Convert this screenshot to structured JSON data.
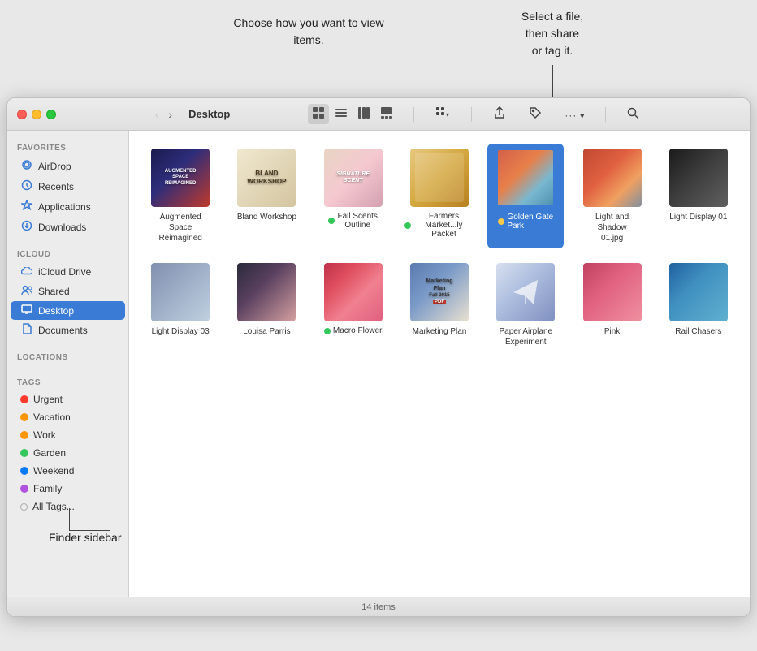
{
  "window": {
    "title": "Desktop"
  },
  "annotations": {
    "view_callout": "Choose how you\nwant to view items.",
    "share_callout": "Select a file,\nthen share\nor tag it.",
    "sidebar_label": "Finder sidebar"
  },
  "sidebar": {
    "favorites_header": "Favorites",
    "icloud_header": "iCloud",
    "locations_header": "Locations",
    "tags_header": "Tags",
    "favorites": [
      {
        "id": "airdrop",
        "label": "AirDrop",
        "icon": "📡"
      },
      {
        "id": "recents",
        "label": "Recents",
        "icon": "🕐"
      },
      {
        "id": "applications",
        "label": "Applications",
        "icon": "🚀"
      },
      {
        "id": "downloads",
        "label": "Downloads",
        "icon": "⬇"
      }
    ],
    "icloud": [
      {
        "id": "icloud-drive",
        "label": "iCloud Drive",
        "icon": "☁"
      },
      {
        "id": "shared",
        "label": "Shared",
        "icon": "👥"
      },
      {
        "id": "desktop",
        "label": "Desktop",
        "icon": "🖥",
        "active": true
      },
      {
        "id": "documents",
        "label": "Documents",
        "icon": "📄"
      }
    ],
    "tags": [
      {
        "id": "urgent",
        "label": "Urgent",
        "color": "#ff3b30"
      },
      {
        "id": "vacation",
        "label": "Vacation",
        "color": "#ff9500"
      },
      {
        "id": "work",
        "label": "Work",
        "color": "#ff9500"
      },
      {
        "id": "garden",
        "label": "Garden",
        "color": "#34c759"
      },
      {
        "id": "weekend",
        "label": "Weekend",
        "color": "#007aff"
      },
      {
        "id": "family",
        "label": "Family",
        "color": "#af52de"
      },
      {
        "id": "all-tags",
        "label": "All Tags...",
        "color": "#aaa"
      }
    ]
  },
  "toolbar": {
    "view_icon": "⊞",
    "list_icon": "≡",
    "column_icon": "⫿",
    "gallery_icon": "⊟",
    "group_icon": "⊞",
    "share_icon": "↑",
    "tag_icon": "🏷",
    "more_icon": "•••",
    "search_icon": "🔍",
    "back_disabled": true,
    "forward_enabled": true
  },
  "files": [
    {
      "id": "augmented",
      "label": "Augmented\nSpace Reimagined",
      "thumb_class": "thumb-augmented",
      "dot": null,
      "selected": false,
      "text_overlay": "AUGMENTED\nSPACE\nREIMAGINED"
    },
    {
      "id": "bland-workshop",
      "label": "Bland Workshop",
      "thumb_class": "thumb-bland",
      "dot": null,
      "selected": false,
      "text_overlay": "BLAND\nWORKSHOP"
    },
    {
      "id": "fall-scents",
      "label": "Fall Scents\nOutline",
      "thumb_class": "thumb-fall-scents",
      "dot": "#34c759",
      "selected": false,
      "text_overlay": "SIGNATURE\nSCENT"
    },
    {
      "id": "farmers-market",
      "label": "Farmers\nMarket...ly Packet",
      "thumb_class": "thumb-farmers",
      "dot": "#34c759",
      "selected": false,
      "text_overlay": ""
    },
    {
      "id": "golden-gate",
      "label": "Golden Gate\nPark",
      "thumb_class": "thumb-golden-gate",
      "dot": null,
      "selected": true,
      "text_overlay": ""
    },
    {
      "id": "light-shadow",
      "label": "Light and Shadow\n01.jpg",
      "thumb_class": "thumb-light-shadow",
      "dot": null,
      "selected": false,
      "text_overlay": ""
    },
    {
      "id": "light-display-01",
      "label": "Light Display 01",
      "thumb_class": "thumb-light-display-01",
      "dot": null,
      "selected": false,
      "text_overlay": ""
    },
    {
      "id": "light-display-03",
      "label": "Light Display 03",
      "thumb_class": "thumb-light-display-03",
      "dot": null,
      "selected": false,
      "text_overlay": ""
    },
    {
      "id": "louisa-parris",
      "label": "Louisa Parris",
      "thumb_class": "thumb-louisa",
      "dot": null,
      "selected": false,
      "text_overlay": ""
    },
    {
      "id": "macro-flower",
      "label": "Macro Flower",
      "thumb_class": "thumb-macro-flower",
      "dot": "#34c759",
      "selected": false,
      "text_overlay": ""
    },
    {
      "id": "marketing-plan",
      "label": "Marketing Plan",
      "thumb_class": "thumb-marketing",
      "dot": null,
      "selected": false,
      "text_overlay": "Marketing\nPlan\n2015\nPDF"
    },
    {
      "id": "paper-airplane",
      "label": "Paper Airplane\nExperiment",
      "thumb_class": "thumb-paper-airplane",
      "dot": null,
      "selected": false,
      "text_overlay": ""
    },
    {
      "id": "pink",
      "label": "Pink",
      "thumb_class": "thumb-pink",
      "dot": null,
      "selected": false,
      "text_overlay": ""
    },
    {
      "id": "rail-chasers",
      "label": "Rail Chasers",
      "thumb_class": "thumb-rail-chasers",
      "dot": null,
      "selected": false,
      "text_overlay": ""
    }
  ],
  "status": {
    "text": "14 items"
  }
}
